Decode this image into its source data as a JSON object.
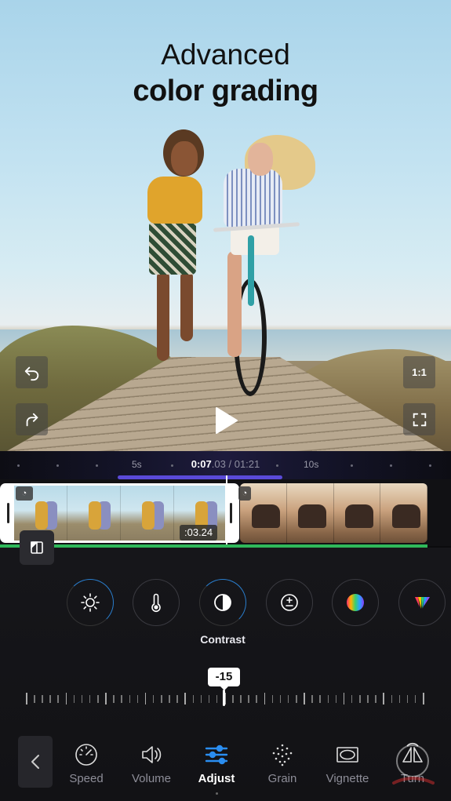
{
  "headline": {
    "line1": "Advanced",
    "line2": "color grading"
  },
  "preview": {
    "aspect_ratio_label": "1:1",
    "icons": {
      "undo": "undo-icon",
      "redo": "redo-icon",
      "fullscreen": "fullscreen-icon",
      "play": "play-icon"
    }
  },
  "timeline": {
    "marks": [
      "5s",
      "10s"
    ],
    "current_time_main": "0:07",
    "current_time_frac": ".03",
    "total_time": "/ 01:21",
    "clip1_duration": ":03.24"
  },
  "adjust": {
    "tools": [
      {
        "id": "brightness",
        "icon": "sun-icon"
      },
      {
        "id": "temperature",
        "icon": "thermometer-icon"
      },
      {
        "id": "contrast",
        "icon": "contrast-icon"
      },
      {
        "id": "exposure",
        "icon": "exposure-icon"
      },
      {
        "id": "saturation",
        "icon": "color-wheel-icon"
      },
      {
        "id": "hsl",
        "icon": "rgb-prism-icon"
      }
    ],
    "selected_label": "Contrast",
    "slider_value": "-15",
    "slider_level": -15,
    "accent_color": "#2a7dcc"
  },
  "toolbar": {
    "tabs": [
      {
        "label": "Speed",
        "icon": "speedometer-icon"
      },
      {
        "label": "Volume",
        "icon": "speaker-icon"
      },
      {
        "label": "Adjust",
        "icon": "sliders-icon",
        "active": true
      },
      {
        "label": "Grain",
        "icon": "grain-icon"
      },
      {
        "label": "Vignette",
        "icon": "vignette-icon"
      },
      {
        "label": "Turn",
        "icon": "flip-icon"
      }
    ]
  },
  "colors": {
    "timeline_accent": "#5a4ad8",
    "track_line": "#2fb85a"
  }
}
